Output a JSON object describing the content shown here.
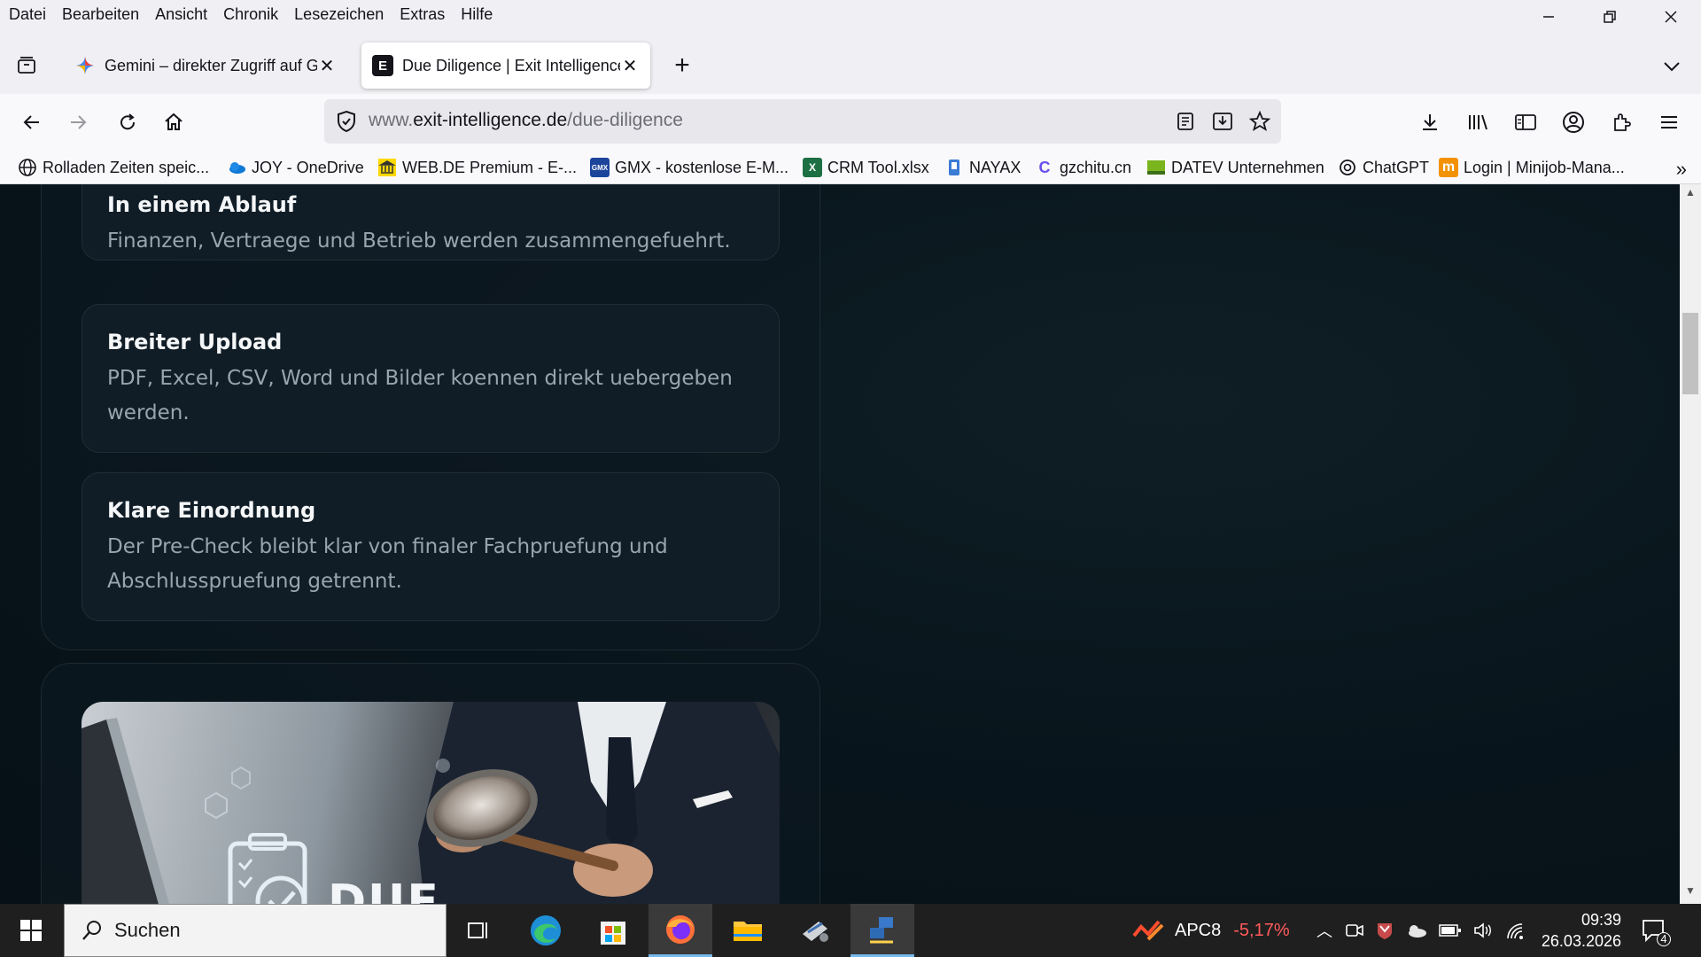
{
  "menu": [
    "Datei",
    "Bearbeiten",
    "Ansicht",
    "Chronik",
    "Lesezeichen",
    "Extras",
    "Hilfe"
  ],
  "tabs": [
    {
      "title": "Gemini – direkter Zugriff auf Go",
      "icon": "gemini-icon"
    },
    {
      "title": "Due Diligence | Exit Intelligence",
      "icon": "exit-intelligence-icon",
      "favicon_letter": "E"
    }
  ],
  "url": {
    "domain_prefix": "www.",
    "domain": "exit-intelligence.de",
    "path": "/due-diligence"
  },
  "bookmarks": [
    {
      "label": "Rolladen Zeiten speic...",
      "icon": "globe-icon"
    },
    {
      "label": "JOY - OneDrive",
      "icon": "onedrive-icon"
    },
    {
      "label": "WEB.DE Premium - E-...",
      "icon": "webde-icon"
    },
    {
      "label": "GMX - kostenlose E-M...",
      "icon": "gmx-icon",
      "badge": "GMX"
    },
    {
      "label": "CRM Tool.xlsx",
      "icon": "excel-icon",
      "badge": "X"
    },
    {
      "label": "NAYAX",
      "icon": "nayax-icon"
    },
    {
      "label": "gzchitu.cn",
      "icon": "gzchitu-icon",
      "badge": "C"
    },
    {
      "label": "DATEV Unternehmen",
      "icon": "datev-icon"
    },
    {
      "label": "ChatGPT",
      "icon": "chatgpt-icon"
    },
    {
      "label": "Login | Minijob-Mana...",
      "icon": "minijob-icon",
      "badge": "m"
    }
  ],
  "cards": [
    {
      "title": "In einem Ablauf",
      "text": "Finanzen, Vertraege und Betrieb werden zusammengefuehrt."
    },
    {
      "title": "Breiter Upload",
      "text": "PDF, Excel, CSV, Word und Bilder koennen direkt uebergeben werden."
    },
    {
      "title": "Klare Einordnung",
      "text": "Der Pre-Check bleibt klar von finaler Fachpruefung und Abschlusspruefung getrennt."
    }
  ],
  "hero_image": {
    "overlay_text": "DUE"
  },
  "taskbar": {
    "search_placeholder": "Suchen",
    "stock_name": "APC8",
    "stock_change": "-5,17%",
    "time": "09:39",
    "date": "26.03.2026",
    "notifications": "4"
  },
  "colors": {
    "accent": "#0060df",
    "stock_negative": "#ff5a5a",
    "page_bg": "#08141b",
    "card_bg": "#111d26"
  }
}
